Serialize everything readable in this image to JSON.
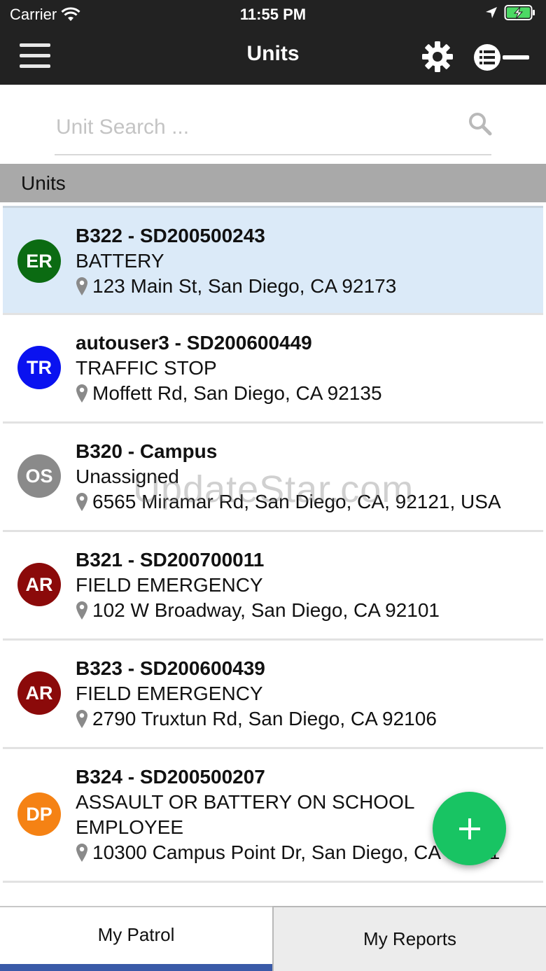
{
  "status_bar": {
    "carrier": "Carrier",
    "time": "11:55 PM"
  },
  "nav": {
    "title": "Units"
  },
  "search": {
    "placeholder": "Unit Search ..."
  },
  "section": {
    "title": "Units"
  },
  "units": [
    {
      "initials": "ER",
      "color": "#0b6b12",
      "title": "B322 - SD200500243",
      "status": "BATTERY",
      "address": "123 Main St, San Diego, CA 92173",
      "selected": true
    },
    {
      "initials": "TR",
      "color": "#0a12f0",
      "title": "autouser3 - SD200600449",
      "status": "TRAFFIC STOP",
      "address": "Moffett Rd, San Diego, CA 92135",
      "selected": false
    },
    {
      "initials": "OS",
      "color": "#8a8a8a",
      "title": "B320 - Campus",
      "status": "Unassigned",
      "address": "6565 Miramar Rd, San Diego, CA, 92121, USA",
      "selected": false
    },
    {
      "initials": "AR",
      "color": "#8b0a0a",
      "title": "B321 - SD200700011",
      "status": "FIELD EMERGENCY",
      "address": "102 W Broadway, San Diego, CA 92101",
      "selected": false
    },
    {
      "initials": "AR",
      "color": "#8b0a0a",
      "title": "B323 - SD200600439",
      "status": "FIELD EMERGENCY",
      "address": "2790 Truxtun Rd, San Diego, CA 92106",
      "selected": false
    },
    {
      "initials": "DP",
      "color": "#f58214",
      "title": "B324 - SD200500207",
      "status": "ASSAULT OR BATTERY ON SCHOOL EMPLOYEE",
      "address": "10300 Campus Point Dr, San Diego, CA 92121",
      "selected": false
    }
  ],
  "watermark": "UpdateStar.com",
  "tabs": [
    {
      "label": "My Patrol",
      "active": true
    },
    {
      "label": "My Reports",
      "active": false
    }
  ],
  "colors": {
    "nav_bg": "#222222",
    "selected_row": "#dbeaf8",
    "fab": "#18c463",
    "tab_active": "#3a5aa8"
  }
}
